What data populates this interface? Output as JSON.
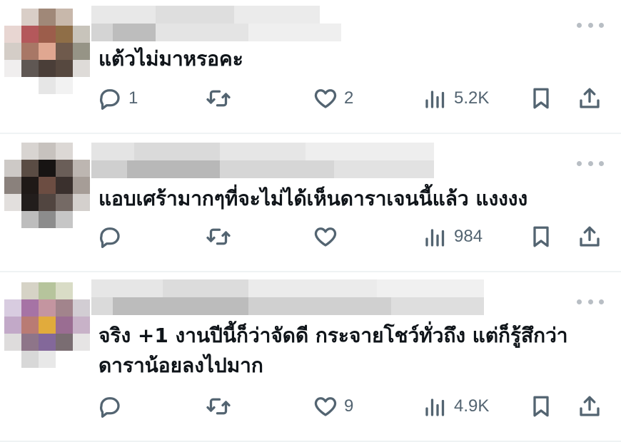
{
  "feed": {
    "tweets": [
      {
        "text": "แต้วไม่มาหรอคะ",
        "replies": "1",
        "retweets": "",
        "likes": "2",
        "views": "5.2K"
      },
      {
        "text": "แอบเศร้ามากๆที่จะไม่ได้เห็นดาราเจนนี้แล้ว แงงงง",
        "replies": "",
        "retweets": "",
        "likes": "",
        "views": "984"
      },
      {
        "text": "จริง +1 งานปีนี้ก็ว่าจัดดี กระจายโชว์ทั่วถึง แต่ก็รู้สึกว่าดาราน้อยลงไปมาก",
        "replies": "",
        "retweets": "",
        "likes": "9",
        "views": "4.9K"
      }
    ]
  },
  "icons": {
    "reply": "speech-bubble-icon",
    "retweet": "retweet-arrows-icon",
    "like": "heart-icon",
    "views": "bar-chart-icon",
    "bookmark": "bookmark-icon",
    "share": "share-upload-icon",
    "more": "more-dots-icon"
  },
  "colors": {
    "icon_gray": "#536471",
    "text": "#0f1419",
    "divider": "#eff3f4",
    "more_dots": "#b8bec4"
  }
}
